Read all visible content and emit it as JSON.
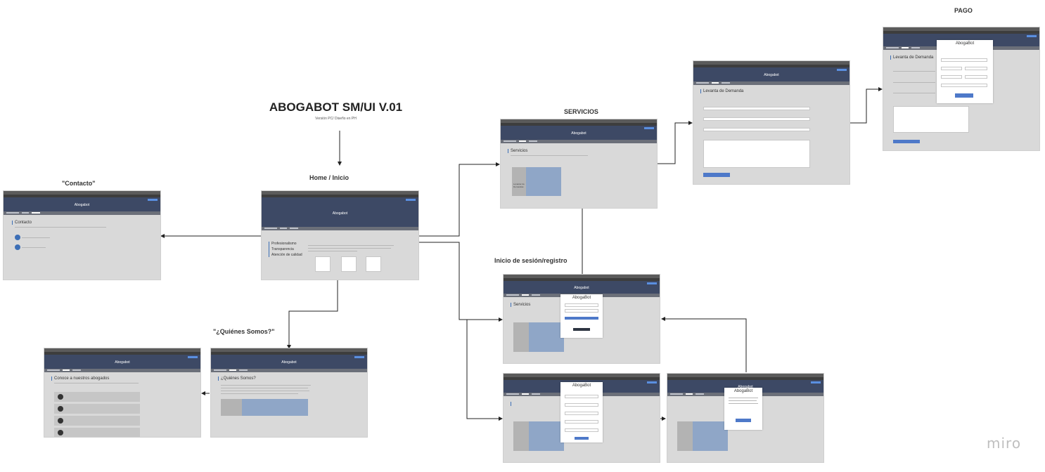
{
  "board": {
    "title": "ABOGABOT SM/UI V.01",
    "subtitle": "Versión PC/ Diseño en PH",
    "watermark": "miro",
    "accent_color": "#3d4965",
    "button_color": "#4e79c9"
  },
  "labels": {
    "home": "Home / Inicio",
    "contacto": "\"Contacto\"",
    "quienes": "\"¿Quiénes Somos?\"",
    "servicios": "SERVICIOS",
    "login": "Inicio de sesión/registro",
    "pago": "PAGO"
  },
  "screens": {
    "brand": "Abogabot",
    "contacto": {
      "heading": "Contacto"
    },
    "home": {
      "features": [
        "Profesionalismo",
        "Transparencia",
        "Atención de calidad"
      ]
    },
    "quienes": {
      "heading": "¿Quiénes Somos?"
    },
    "abogados": {
      "heading": "Conoce a nuestros abogados"
    },
    "servicios": {
      "heading": "Servicios",
      "image_caption": "Levantar de Demandas"
    },
    "demanda": {
      "heading": "Levanta de Demanda"
    },
    "login": {
      "heading": "Servicios",
      "modal_title": "AbogaBot"
    },
    "registro": {
      "modal_title": "AbogaBot"
    },
    "confirm": {
      "modal_title": "AbogaBot"
    },
    "pago": {
      "heading": "Levanta de Demanda",
      "modal_title": "AbogaBot"
    }
  }
}
